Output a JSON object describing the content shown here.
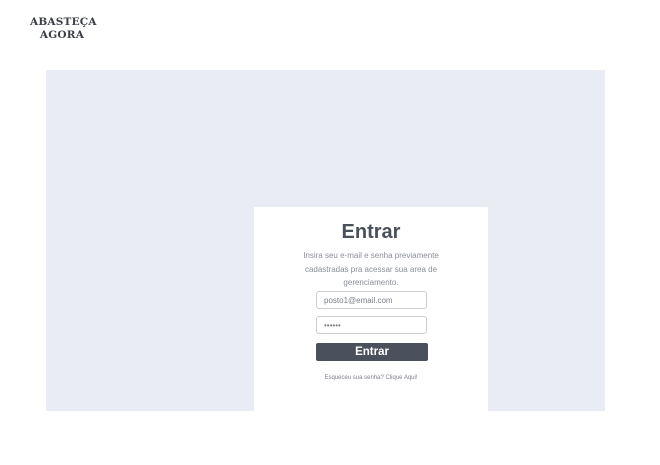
{
  "brand": {
    "line1": "ABASTEÇA",
    "line2": "AGORA"
  },
  "login": {
    "title": "Entrar",
    "description": "Insira seu e-mail e senha previamente cadastradas pra acessar sua area de gerenciamento.",
    "email": {
      "value": "posto1@email.com"
    },
    "password": {
      "value": "••••••"
    },
    "submit_label": "Entrar",
    "forgot_link": "Esqueceu sua senha? Clique Aqui!"
  }
}
